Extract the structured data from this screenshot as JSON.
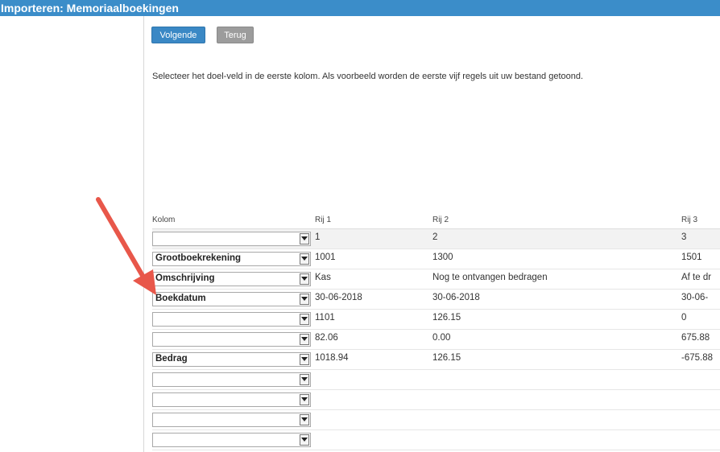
{
  "window": {
    "title": "Importeren: Memoriaalboekingen"
  },
  "toolbar": {
    "next_label": "Volgende",
    "back_label": "Terug"
  },
  "instruction": "Selecteer het doel-veld in de eerste kolom. Als voorbeeld worden de eerste vijf regels uit uw bestand getoond.",
  "colors": {
    "titlebar": "#3b8dc9",
    "primary_button": "#3a88c5",
    "secondary_button": "#9c9c9c",
    "annotation_arrow": "#e8574a"
  },
  "grid": {
    "headers": [
      "Kolom",
      "Rij 1",
      "Rij 2",
      "Rij 3"
    ],
    "rows": [
      {
        "field": "",
        "values": [
          "1",
          "2",
          "3"
        ]
      },
      {
        "field": "Grootboekrekening",
        "values": [
          "1001",
          "1300",
          "1501"
        ]
      },
      {
        "field": "Omschrijving",
        "values": [
          "Kas",
          "Nog te ontvangen bedragen",
          "Af te dr"
        ]
      },
      {
        "field": "Boekdatum",
        "values": [
          "30-06-2018",
          "30-06-2018",
          "30-06-"
        ]
      },
      {
        "field": "",
        "values": [
          "1101",
          "126.15",
          "0"
        ]
      },
      {
        "field": "",
        "values": [
          "82.06",
          "0.00",
          "675.88"
        ]
      },
      {
        "field": "Bedrag",
        "values": [
          "1018.94",
          "126.15",
          "-675.88"
        ]
      },
      {
        "field": "",
        "values": [
          "",
          "",
          ""
        ]
      },
      {
        "field": "",
        "values": [
          "",
          "",
          ""
        ]
      },
      {
        "field": "",
        "values": [
          "",
          "",
          ""
        ]
      },
      {
        "field": "",
        "values": [
          "",
          "",
          ""
        ]
      }
    ]
  }
}
